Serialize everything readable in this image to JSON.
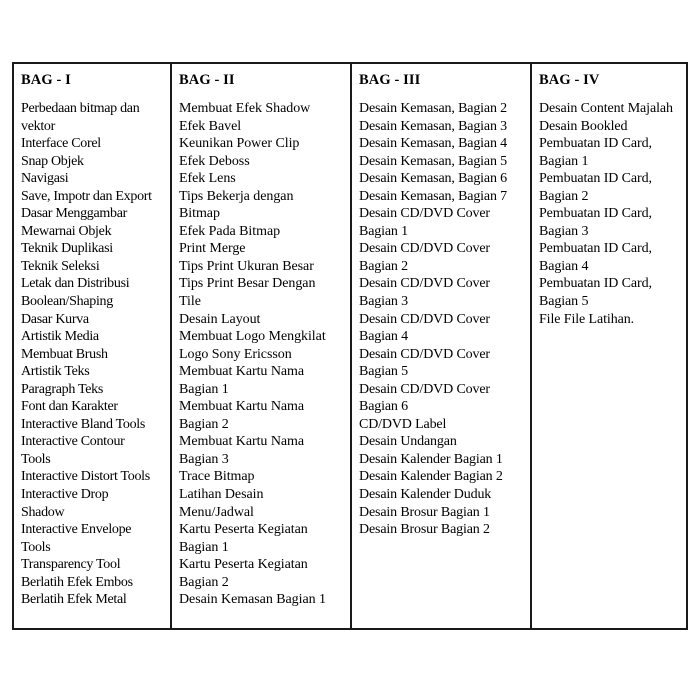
{
  "document": {
    "type": "table",
    "background_color": "#ffffff",
    "text_color": "#000000",
    "border_color": "#1a1a1a",
    "columns": [
      {
        "header": "BAG - I",
        "items": [
          "Perbedaan bitmap dan",
          "vektor",
          "Interface Corel",
          "Snap Objek",
          "Navigasi",
          "Save, Impotr dan Export",
          "Dasar Menggambar",
          "Mewarnai Objek",
          "Teknik Duplikasi",
          "Teknik Seleksi",
          "Letak dan Distribusi",
          "Boolean/Shaping",
          "Dasar Kurva",
          "Artistik Media",
          "Membuat Brush",
          "Artistik Teks",
          "Paragraph Teks",
          "Font dan Karakter",
          "Interactive Bland Tools",
          "Interactive Contour",
          "Tools",
          "Interactive Distort Tools",
          "Interactive Drop",
          "Shadow",
          "Interactive Envelope",
          "Tools",
          "Transparency Tool",
          "Berlatih Efek Embos",
          "Berlatih Efek Metal"
        ]
      },
      {
        "header": "BAG - II",
        "items": [
          "Membuat Efek Shadow",
          "Efek Bavel",
          "Keunikan Power Clip",
          "Efek Deboss",
          "Efek Lens",
          "Tips Bekerja dengan",
          "Bitmap",
          "Efek Pada Bitmap",
          "Print Merge",
          "Tips Print Ukuran Besar",
          "Tips Print Besar Dengan",
          "Tile",
          "Desain Layout",
          "Membuat Logo Mengkilat",
          "Logo Sony Ericsson",
          "Membuat Kartu Nama",
          "Bagian 1",
          "Membuat Kartu Nama",
          "Bagian 2",
          "Membuat Kartu Nama",
          "Bagian 3",
          "Trace Bitmap",
          "Latihan Desain",
          "Menu/Jadwal",
          "Kartu Peserta Kegiatan",
          "Bagian 1",
          "Kartu Peserta Kegiatan",
          "Bagian 2",
          "Desain Kemasan Bagian 1"
        ]
      },
      {
        "header": "BAG - III",
        "items": [
          "Desain Kemasan, Bagian 2",
          "Desain Kemasan, Bagian 3",
          "Desain Kemasan, Bagian 4",
          "Desain Kemasan, Bagian 5",
          "Desain Kemasan, Bagian 6",
          "Desain Kemasan, Bagian 7",
          "Desain CD/DVD Cover",
          "Bagian 1",
          "Desain CD/DVD Cover",
          "Bagian 2",
          "Desain CD/DVD Cover",
          "Bagian 3",
          "Desain CD/DVD Cover",
          "Bagian 4",
          "Desain CD/DVD Cover",
          "Bagian 5",
          "Desain CD/DVD Cover",
          "Bagian 6",
          "CD/DVD Label",
          "Desain Undangan",
          "Desain Kalender Bagian 1",
          "Desain Kalender Bagian 2",
          "Desain Kalender Duduk",
          "Desain Brosur Bagian 1",
          "Desain Brosur Bagian 2"
        ]
      },
      {
        "header": "BAG - IV",
        "items": [
          "Desain Content Majalah",
          "Desain Bookled",
          "Pembuatan ID Card,",
          "Bagian 1",
          "Pembuatan ID Card,",
          "Bagian 2",
          "Pembuatan ID Card,",
          "Bagian 3",
          "Pembuatan ID Card,",
          "Bagian 4",
          "Pembuatan ID Card,",
          "Bagian 5",
          "File File Latihan."
        ]
      }
    ]
  }
}
